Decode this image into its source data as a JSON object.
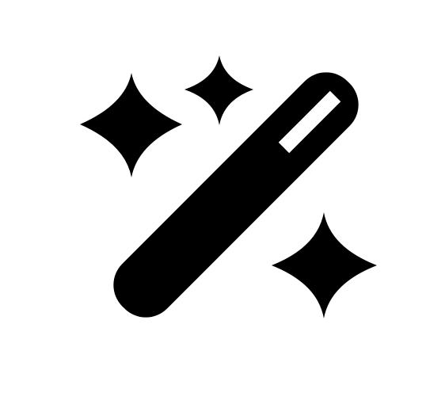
{
  "icon": {
    "name": "magic-wand-icon",
    "color": "#000000",
    "background": "#ffffff"
  }
}
